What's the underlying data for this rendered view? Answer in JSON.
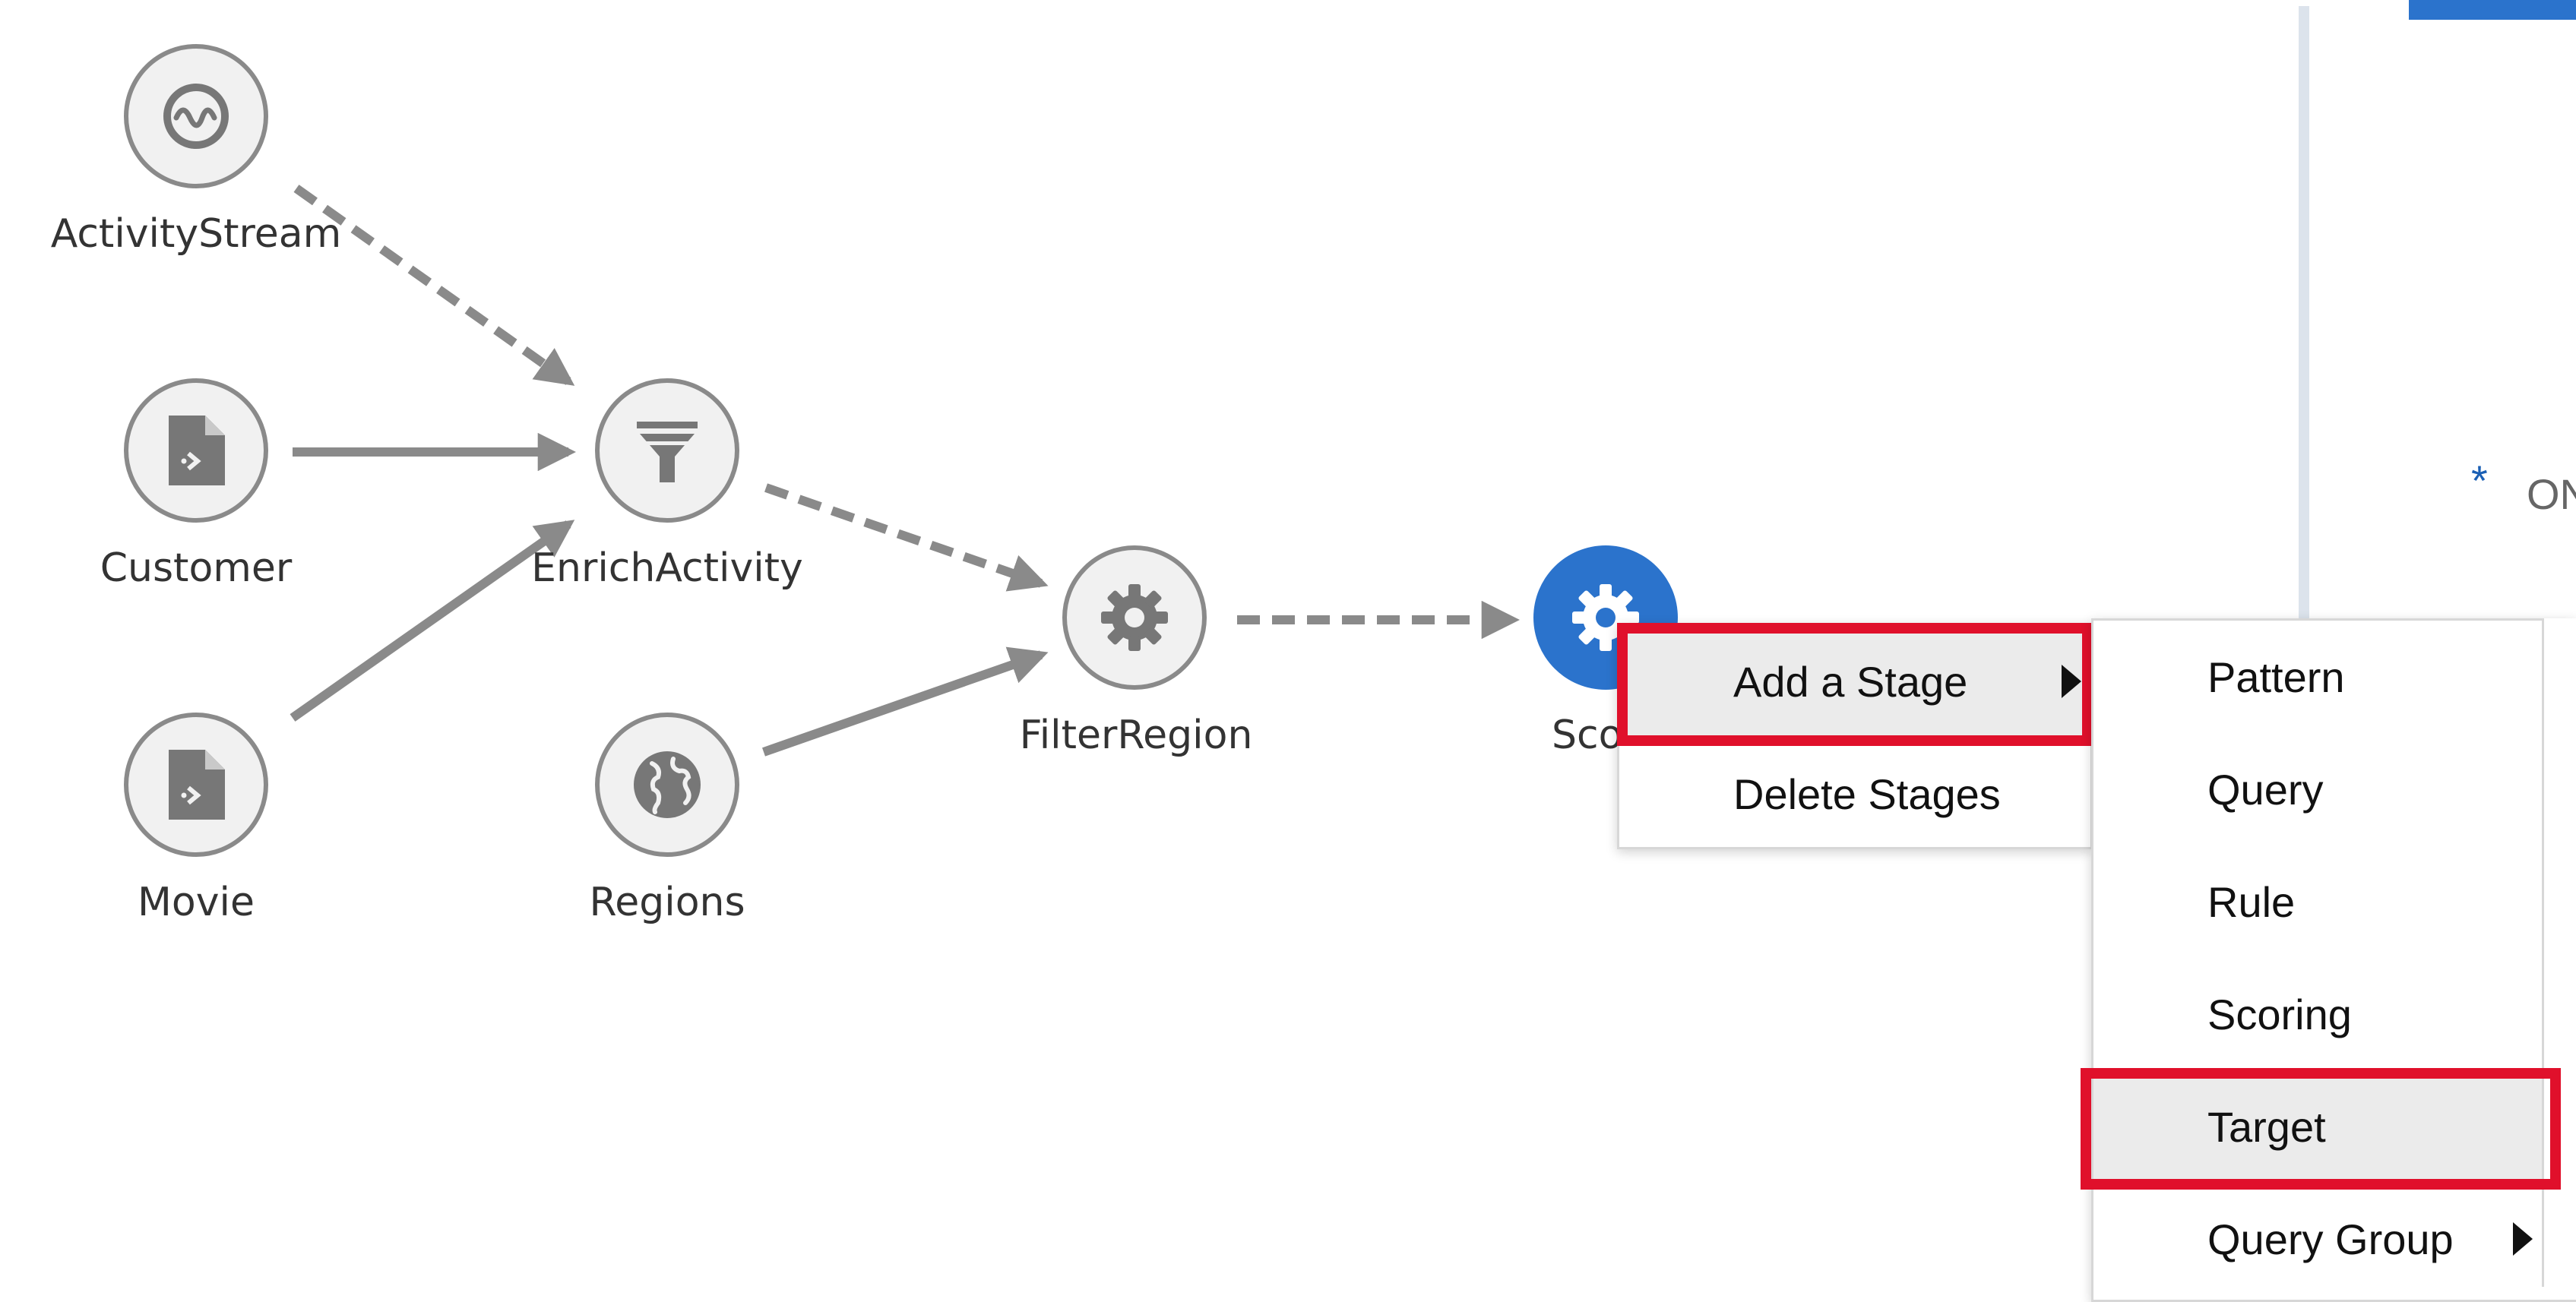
{
  "pipeline": {
    "nodes": [
      {
        "label": "ActivityStream",
        "icon": "stream-icon"
      },
      {
        "label": "Customer",
        "icon": "file-icon"
      },
      {
        "label": "Movie",
        "icon": "file-icon"
      },
      {
        "label": "EnrichActivity",
        "icon": "filter-icon"
      },
      {
        "label": "Regions",
        "icon": "globe-icon"
      },
      {
        "label": "FilterRegion",
        "icon": "gear-icon"
      },
      {
        "label": "Scoring",
        "visible_label": "Sco",
        "icon": "gear-icon",
        "selected": true
      }
    ],
    "edges": [
      {
        "from": "ActivityStream",
        "to": "EnrichActivity",
        "style": "dashed"
      },
      {
        "from": "Customer",
        "to": "EnrichActivity",
        "style": "solid"
      },
      {
        "from": "Movie",
        "to": "EnrichActivity",
        "style": "solid"
      },
      {
        "from": "EnrichActivity",
        "to": "FilterRegion",
        "style": "dashed"
      },
      {
        "from": "Regions",
        "to": "FilterRegion",
        "style": "solid"
      },
      {
        "from": "FilterRegion",
        "to": "Scoring",
        "style": "dashed"
      }
    ]
  },
  "context_menu": {
    "items": [
      {
        "label": "Add a Stage",
        "has_submenu": true,
        "highlighted": true
      },
      {
        "label": "Delete Stages",
        "has_submenu": false
      }
    ]
  },
  "submenu": {
    "items": [
      {
        "label": "Pattern"
      },
      {
        "label": "Query"
      },
      {
        "label": "Rule"
      },
      {
        "label": "Scoring"
      },
      {
        "label": "Target",
        "highlighted": true
      },
      {
        "label": "Query Group",
        "has_submenu": true
      }
    ]
  },
  "right_panel": {
    "required_marker": "*",
    "partial_label": "ON"
  },
  "colors": {
    "accent": "#2b73cc",
    "highlight_box": "#e0102b",
    "node_border": "#8a8a8a",
    "node_fill": "#f1f1f1",
    "edge": "#8a8a8a"
  }
}
